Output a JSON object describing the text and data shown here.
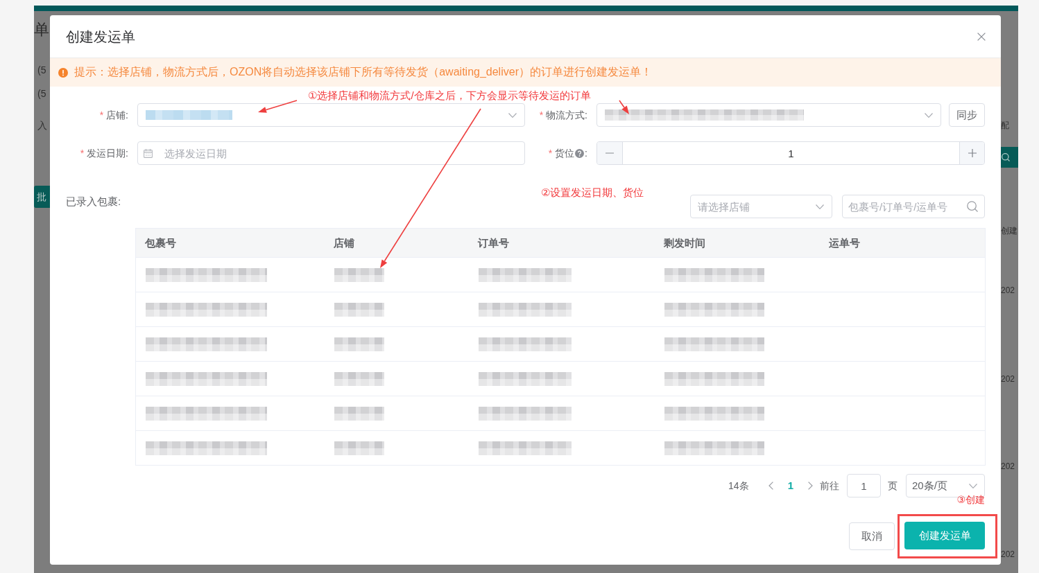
{
  "background_page": {
    "left_items": [
      {
        "kind": "title",
        "text": "单"
      },
      {
        "kind": "text",
        "text": "(5"
      },
      {
        "kind": "text",
        "text": "(5"
      },
      {
        "kind": "text",
        "text": "入"
      },
      {
        "kind": "button",
        "text": "批"
      }
    ],
    "right_items": [
      {
        "kind": "text",
        "text": "配"
      },
      {
        "kind": "icon_button"
      },
      {
        "kind": "text",
        "text": "创建"
      },
      {
        "kind": "text",
        "text": "202"
      },
      {
        "kind": "text",
        "text": "202"
      },
      {
        "kind": "text",
        "text": "202"
      },
      {
        "kind": "text",
        "text": "202"
      }
    ]
  },
  "dialog": {
    "title": "创建发运单",
    "alert": {
      "text": "提示：选择店铺，物流方式后，OZON将自动选择该店铺下所有等待发货（awaiting_deliver）的订单进行创建发运单！"
    },
    "annotations": [
      {
        "text": "①选择店铺和物流方式/仓库之后，下方会显示等待发运的订单"
      },
      {
        "text": "②设置发运日期、货位"
      },
      {
        "text": "③创建"
      }
    ],
    "fields": [
      {
        "kind": "select",
        "required_mark": "*",
        "label": "店铺:",
        "redacted": true
      },
      {
        "kind": "select",
        "required_mark": "*",
        "label": "物流方式:",
        "redacted": true,
        "button": "同步"
      },
      {
        "kind": "date",
        "required_mark": "*",
        "label": "发运日期:",
        "placeholder": "选择发运日期"
      },
      {
        "kind": "stepper",
        "required_mark": "*",
        "label": "货位",
        "help": true,
        "label_end": ":",
        "value": "1"
      }
    ],
    "packages": {
      "label": "已录入包裹:",
      "store_filter": {
        "placeholder": "请选择店铺"
      },
      "search": {
        "placeholder": "包裹号/订单号/运单号"
      },
      "table": {
        "columns": [
          "包裹号",
          "店铺",
          "订单号",
          "剩发时间",
          "运单号"
        ],
        "rows": [
          {
            "cells": [
              {
                "redacted": true
              },
              {
                "redacted": true
              },
              {
                "redacted": true
              },
              {
                "redacted": true
              }
            ]
          },
          {
            "cells": [
              {
                "redacted": true
              },
              {
                "redacted": true
              },
              {
                "redacted": true
              },
              {
                "redacted": true
              }
            ]
          },
          {
            "cells": [
              {
                "redacted": true
              },
              {
                "redacted": true
              },
              {
                "redacted": true
              },
              {
                "redacted": true
              }
            ]
          },
          {
            "cells": [
              {
                "redacted": true
              },
              {
                "redacted": true
              },
              {
                "redacted": true
              },
              {
                "redacted": true
              }
            ]
          },
          {
            "cells": [
              {
                "redacted": true
              },
              {
                "redacted": true
              },
              {
                "redacted": true
              },
              {
                "redacted": true
              }
            ]
          },
          {
            "cells": [
              {
                "redacted": true
              },
              {
                "redacted": true
              },
              {
                "redacted": true
              },
              {
                "redacted": true
              }
            ]
          }
        ]
      },
      "pagination": {
        "total": "14条",
        "pages": [
          {
            "label": "1",
            "selected": true
          }
        ],
        "goto_label": "前往",
        "goto_value": "1",
        "page_unit": "页",
        "page_size": "20条/页"
      }
    },
    "buttons": [
      {
        "kind": "default",
        "label": "取消"
      },
      {
        "kind": "primary",
        "label": "创建发运单",
        "highlighted": true
      }
    ]
  }
}
